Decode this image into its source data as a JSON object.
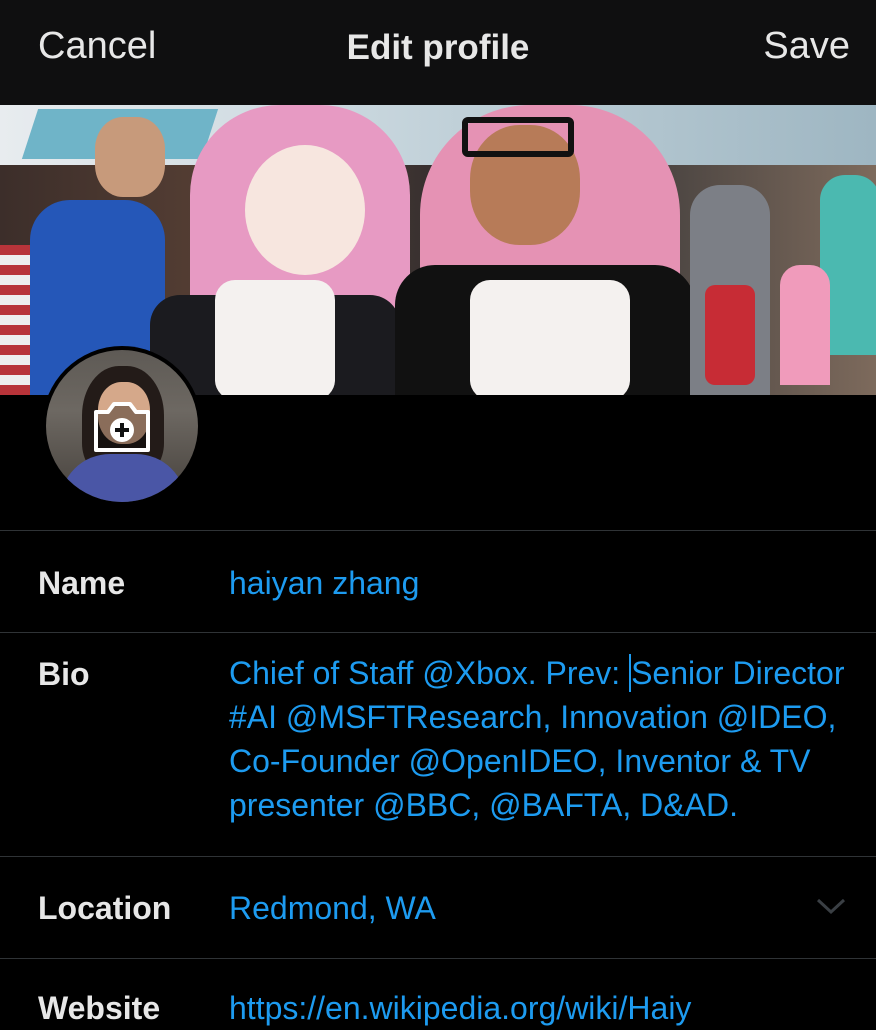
{
  "header": {
    "cancel_label": "Cancel",
    "title": "Edit profile",
    "save_label": "Save"
  },
  "fields": {
    "name": {
      "label": "Name",
      "value": "haiyan zhang"
    },
    "bio": {
      "label": "Bio",
      "value_before_cursor": "Chief of Staff @Xbox. Prev: ",
      "value_after_cursor": "Senior Director #AI @MSFTResearch, Innovation @IDEO, Co-Founder @OpenIDEO, Inventor & TV presenter @BBC, @BAFTA, D&AD."
    },
    "location": {
      "label": "Location",
      "value": "Redmond, WA"
    },
    "website": {
      "label": "Website",
      "value": "https://en.wikipedia.org/wiki/Haiy"
    }
  },
  "icons": {
    "avatar_edit": "camera-plus-icon",
    "location_dropdown": "chevron-down-icon"
  },
  "colors": {
    "background": "#000000",
    "accent": "#1d9bf0",
    "divider": "#2f3336"
  }
}
